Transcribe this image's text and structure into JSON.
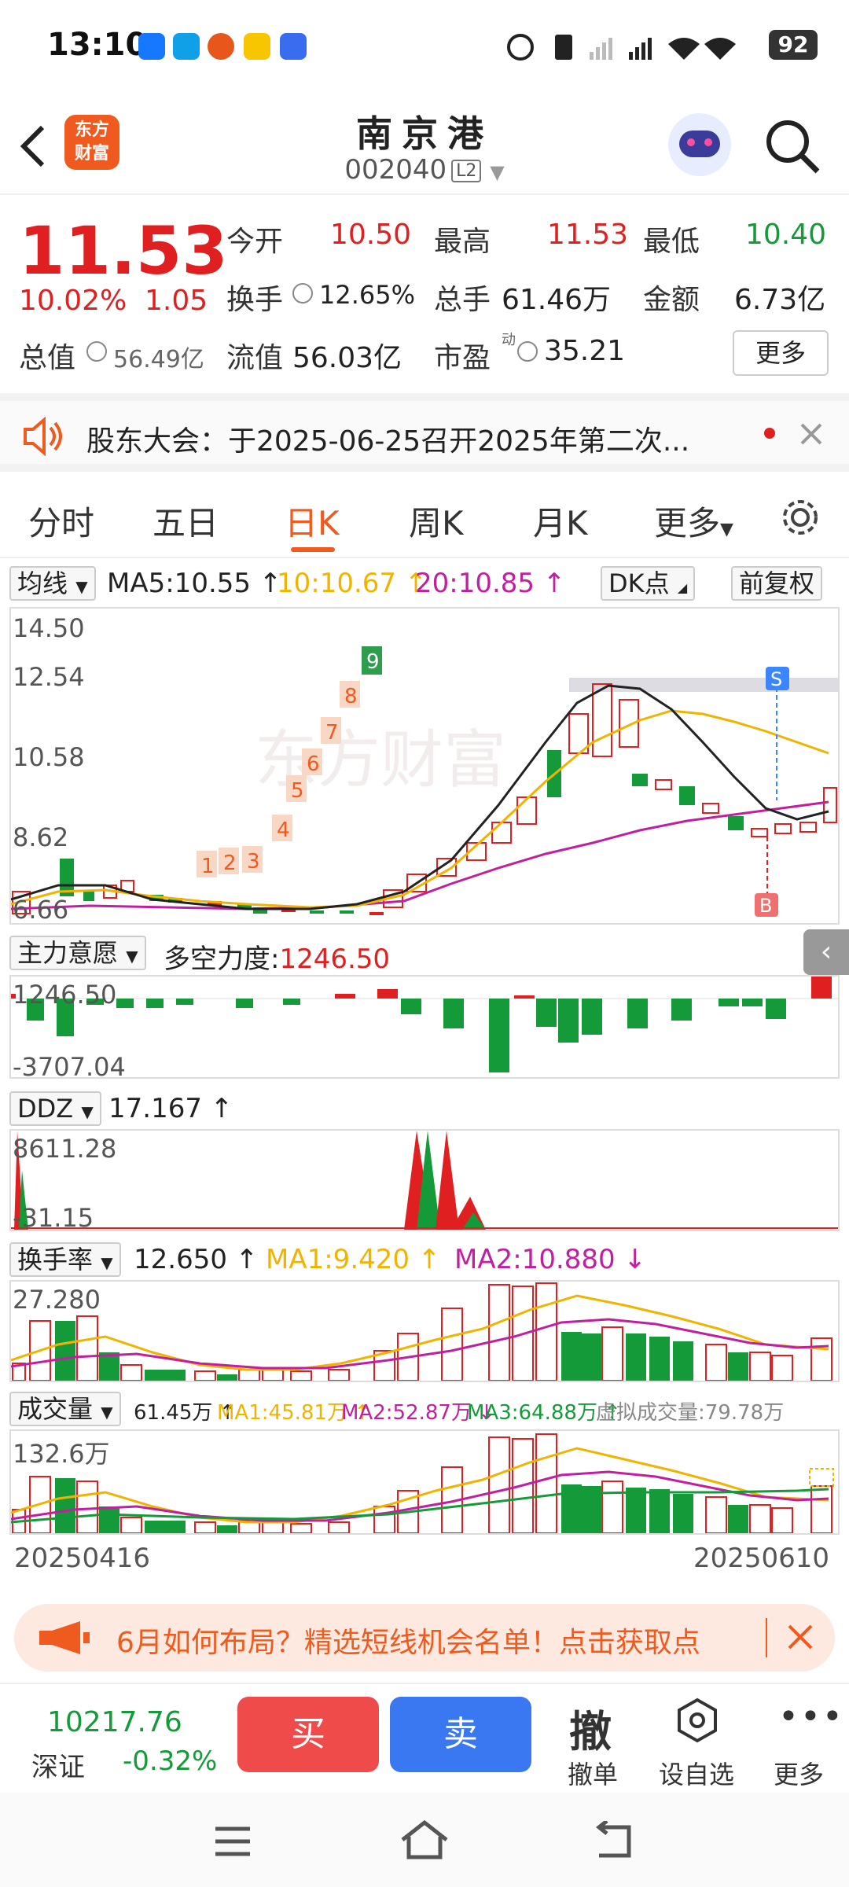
{
  "status_bar": {
    "time": "13:10",
    "battery": "92"
  },
  "header": {
    "back_label": "<",
    "logo_text_1": "东方",
    "logo_text_2": "财富",
    "stock_name": "南京港",
    "stock_code": "002040",
    "level_badge": "L2"
  },
  "quote": {
    "price": "11.53",
    "change_pct": "10.02%",
    "change_abs": "1.05",
    "open_label": "今开",
    "open": "10.50",
    "high_label": "最高",
    "high": "11.53",
    "low_label": "最低",
    "low": "10.40",
    "turnover_label": "换手",
    "turnover": "12.65%",
    "volume_label": "总手",
    "volume": "61.46万",
    "amount_label": "金额",
    "amount": "6.73亿",
    "mktcap_label": "总值",
    "mktcap": "56.49亿",
    "float_label": "流值",
    "float_cap": "56.03亿",
    "pe_label": "市盈",
    "pe_sup": "动",
    "pe": "35.21",
    "more_label": "更多"
  },
  "notice": {
    "text": "股东大会：于2025-06-25召开2025年第二次..."
  },
  "tabs": [
    "分时",
    "五日",
    "日K",
    "周K",
    "月K",
    "更多"
  ],
  "active_tab": "日K",
  "kline": {
    "ma_selector": "均线",
    "ma5": "MA5:10.55 ↑",
    "ma10": "10:10.67 ↑",
    "ma20": "20:10.85 ↑",
    "dk_label": "DK点",
    "fq_label": "前复权",
    "y_labels": [
      "14.50",
      "12.54",
      "10.58",
      "8.62",
      "6.66"
    ],
    "signal_numbers": [
      "1",
      "2",
      "3",
      "4",
      "5",
      "6",
      "7",
      "8",
      "9"
    ],
    "buy_mark": "B",
    "sell_mark": "S",
    "watermark": "东方财富"
  },
  "main_force": {
    "selector": "主力意愿",
    "label": "多空力度:",
    "value": "1246.50",
    "y_top": "1246.50",
    "y_bottom": "-3707.04"
  },
  "ddz": {
    "selector": "DDZ",
    "value": "17.167 ↑",
    "y_top": "8611.28",
    "y_bottom": "-31.15"
  },
  "turnover_rate": {
    "selector": "换手率",
    "value": "12.650 ↑",
    "ma1": "MA1:9.420 ↑",
    "ma2": "MA2:10.880 ↓",
    "y_top": "27.280"
  },
  "volume": {
    "selector": "成交量",
    "value": "61.45万 ↑",
    "ma1": "MA1:45.81万 ↑",
    "ma2": "MA2:52.87万 ↓",
    "ma3": "MA3:64.88万 ↑",
    "virtual": "虚拟成交量:79.78万",
    "y_top": "132.6万"
  },
  "dates": {
    "start": "20250416",
    "end": "20250610"
  },
  "banner": {
    "text": "6月如何布局？精选短线机会名单！点击获取点"
  },
  "tradebar": {
    "index_value": "10217.76",
    "index_name": "深证",
    "index_change": "-0.32%",
    "buy": "买",
    "sell": "卖",
    "cancel_icon": "撤",
    "cancel": "撤单",
    "watch": "设自选",
    "more": "更多"
  },
  "colors": {
    "up": "#e02020",
    "down": "#159a3a",
    "accent": "#ef5a1e",
    "ma10": "#f0b400",
    "ma20": "#c020a0"
  }
}
